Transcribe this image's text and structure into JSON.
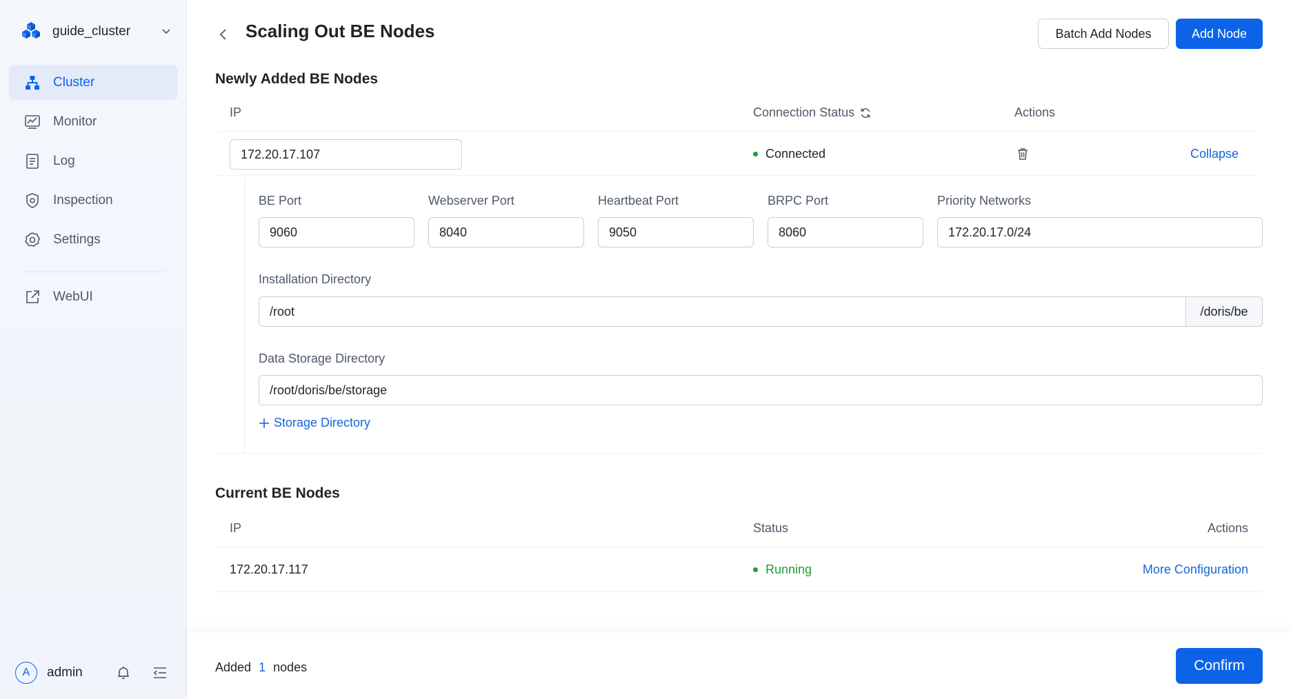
{
  "sidebar": {
    "cluster_name": "guide_cluster",
    "nav_items": [
      {
        "label": "Cluster",
        "icon": "cluster-icon",
        "active": true
      },
      {
        "label": "Monitor",
        "icon": "monitor-icon",
        "active": false
      },
      {
        "label": "Log",
        "icon": "log-icon",
        "active": false
      },
      {
        "label": "Inspection",
        "icon": "shield-icon",
        "active": false
      },
      {
        "label": "Settings",
        "icon": "gear-icon",
        "active": false
      }
    ],
    "webui_label": "WebUI",
    "user": {
      "initial": "A",
      "name": "admin"
    }
  },
  "header": {
    "title": "Scaling Out BE Nodes",
    "batch_add_label": "Batch Add Nodes",
    "add_node_label": "Add Node"
  },
  "new_nodes": {
    "title": "Newly Added BE Nodes",
    "columns": {
      "ip": "IP",
      "connection_status": "Connection Status",
      "actions": "Actions"
    },
    "node": {
      "ip": "172.20.17.107",
      "status": "Connected",
      "collapse_label": "Collapse",
      "fields": {
        "be_port": {
          "label": "BE Port",
          "value": "9060"
        },
        "webserver_port": {
          "label": "Webserver Port",
          "value": "8040"
        },
        "heartbeat_port": {
          "label": "Heartbeat Port",
          "value": "9050"
        },
        "brpc_port": {
          "label": "BRPC Port",
          "value": "8060"
        },
        "priority_networks": {
          "label": "Priority Networks",
          "value": "172.20.17.0/24"
        }
      },
      "install_dir": {
        "label": "Installation Directory",
        "value": "/root",
        "suffix": "/doris/be"
      },
      "storage_dir": {
        "label": "Data Storage Directory",
        "value": "/root/doris/be/storage"
      },
      "add_storage_label": "Storage Directory"
    }
  },
  "current_nodes": {
    "title": "Current BE Nodes",
    "columns": {
      "ip": "IP",
      "status": "Status",
      "actions": "Actions"
    },
    "rows": [
      {
        "ip": "172.20.17.117",
        "status": "Running",
        "action": "More Configuration"
      }
    ]
  },
  "footer": {
    "added_prefix": "Added",
    "added_count": "1",
    "added_suffix": "nodes",
    "confirm_label": "Confirm"
  },
  "colors": {
    "primary": "#0d63e8",
    "link": "#1565d8",
    "success": "#1f9d3a"
  }
}
